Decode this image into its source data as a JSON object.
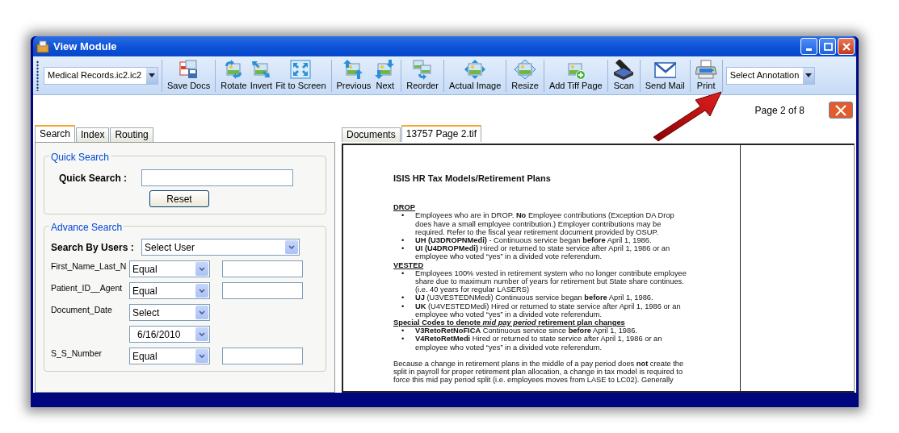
{
  "window": {
    "title": "View Module"
  },
  "toolbar": {
    "file_select": "Medical Records.ic2.ic2",
    "groups": [
      [
        "Save Docs"
      ],
      [
        "Rotate",
        "Invert",
        "Fit to Screen"
      ],
      [
        "Previous",
        "Next"
      ],
      [
        "Reorder"
      ],
      [
        "Actual Image"
      ],
      [
        "Resize"
      ],
      [
        "Add Tiff Page"
      ],
      [
        "Scan"
      ],
      [
        "Send Mail"
      ],
      [
        "Print"
      ]
    ],
    "annotation_select": "Select Annotation"
  },
  "page_indicator": "Page 2 of 8",
  "left_tabs": [
    {
      "label": "Search",
      "selected": true
    },
    {
      "label": "Index",
      "selected": false
    },
    {
      "label": "Routing",
      "selected": false
    }
  ],
  "quick_search": {
    "legend": "Quick Search",
    "label": "Quick Search :",
    "button": "Reset"
  },
  "advance_search": {
    "legend": "Advance Search",
    "users_label": "Search By Users :",
    "users_select": "Select User",
    "fields": [
      {
        "label": "First_Name_Last_N",
        "operator": "Equal",
        "kind": "text"
      },
      {
        "label": "Patient_ID__Agent",
        "operator": "Equal",
        "kind": "text"
      },
      {
        "label": "Document_Date",
        "operator": "Select",
        "kind": "date",
        "date": "6/16/2010"
      },
      {
        "label": "S_S_Number",
        "operator": "Equal",
        "kind": "text"
      }
    ]
  },
  "doc_tabs": [
    {
      "label": "Documents",
      "selected": false
    },
    {
      "label": "13757 Page 2.tif",
      "selected": true
    }
  ],
  "document": {
    "title": "ISIS HR Tax Models/Retirement Plans",
    "sections": [
      {
        "heading": "DROP",
        "items": [
          {
            "bullet": "•",
            "text": "Employees who are in DROP.  **No** Employee contributions (Exception DA Drop does have a small employee contribution.)  Employer contributions may be required.  Refer to the fiscal year retirement document provided by OSUP."
          },
          {
            "bullet": "•",
            "text": "**UH (U3DROPNMedi)** - Continuous service began **before** April 1, 1986."
          },
          {
            "bullet": "•",
            "text": "**UI (U4DROPMedi)** Hired or returned to state service after April 1, 1986 or an employee who voted “yes” in a divided vote referendum."
          }
        ]
      },
      {
        "heading": "VESTED",
        "items": [
          {
            "bullet": "•",
            "text": "Employees 100% vested in retirement system who no longer contribute employee share due to maximum number of years for retirement but State share continues. (i.e. 40 years for regular LASERS)"
          },
          {
            "bullet": "•",
            "text": "**UJ** (U3VESTEDNMedi) Continuous service began **before** April 1, 1986."
          },
          {
            "bullet": "•",
            "text": "**UK** (U4VESTEDMedi) Hired or returned to state service after April 1, 1986 or an employee who voted “yes” in a divided vote referendum."
          }
        ]
      },
      {
        "heading": "Special Codes to denote *mid pay period* retirement plan changes",
        "items": [
          {
            "bullet": "•",
            "text": "**V3RetoRetNoFICA** Continuous service since **before** April 1, 1986."
          },
          {
            "bullet": "•",
            "text": "**V4RetoRetMedi** Hired or returned to state service after April 1, 1986 or an employee who voted “yes” in a divided vote referendum."
          }
        ]
      }
    ],
    "paragraph": "Because a change in retirement plans in the middle of a pay period does **not** create the split in payroll for proper retirement plan allocation, a change in tax model is required to force this mid pay period split (i.e. employees moves from LASE to LC02). Generally"
  }
}
